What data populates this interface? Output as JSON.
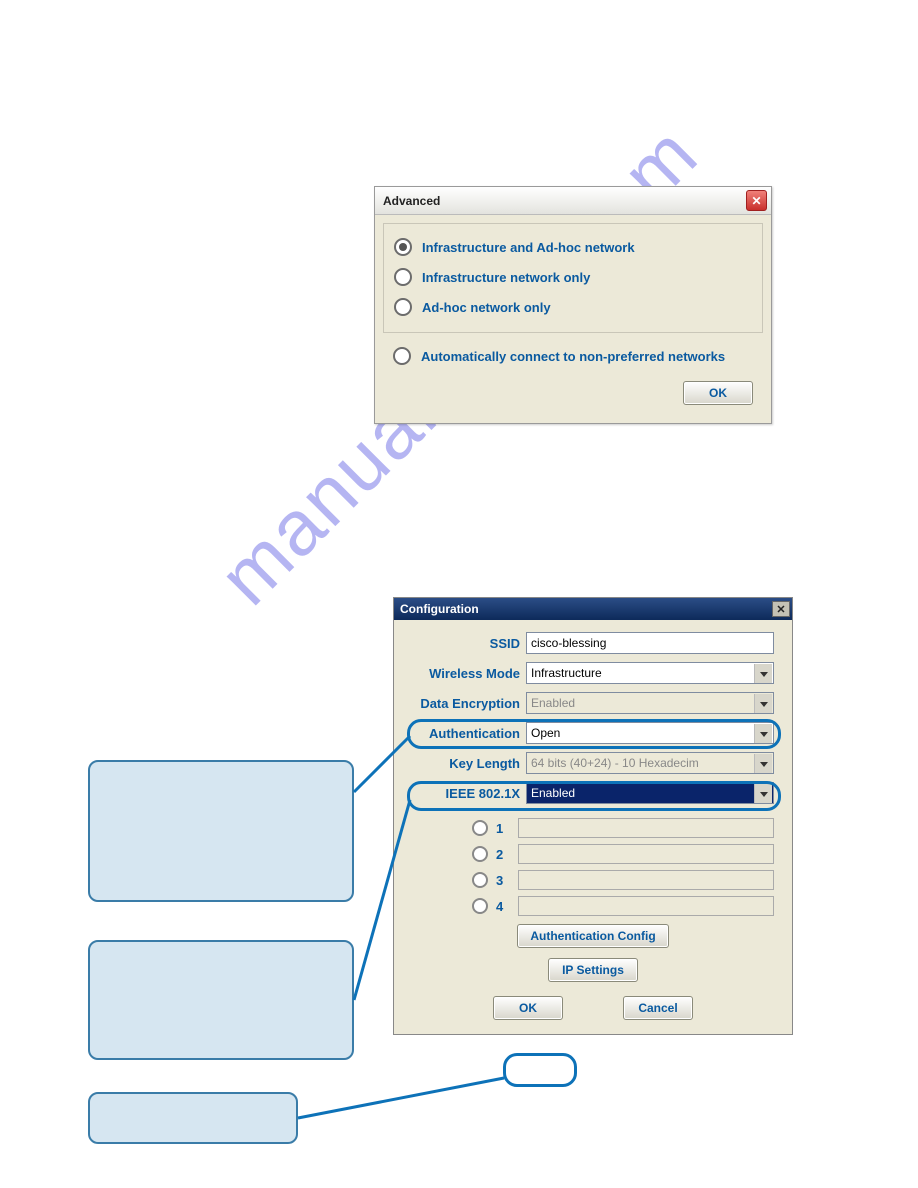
{
  "watermark": "manualshive.com",
  "advanced_dialog": {
    "title": "Advanced",
    "options": {
      "infra_adhoc": "Infrastructure and Ad-hoc network",
      "infra_only": "Infrastructure  network only",
      "adhoc_only": "Ad-hoc network only",
      "auto_connect": "Automatically connect to non-preferred networks"
    },
    "ok": "OK"
  },
  "config_dialog": {
    "title": "Configuration",
    "labels": {
      "ssid": "SSID",
      "wireless_mode": "Wireless Mode",
      "data_encryption": "Data Encryption",
      "authentication": "Authentication",
      "key_length": "Key Length",
      "ieee8021x": "IEEE 802.1X"
    },
    "values": {
      "ssid": "cisco-blessing",
      "wireless_mode": "Infrastructure",
      "data_encryption": "Enabled",
      "authentication": "Open",
      "key_length": "64 bits (40+24) - 10 Hexadecim",
      "ieee8021x": "Enabled"
    },
    "keys": {
      "k1": "1",
      "k2": "2",
      "k3": "3",
      "k4": "4"
    },
    "buttons": {
      "auth_config": "Authentication Config",
      "ip_settings": "IP Settings",
      "ok": "OK",
      "cancel": "Cancel"
    }
  }
}
